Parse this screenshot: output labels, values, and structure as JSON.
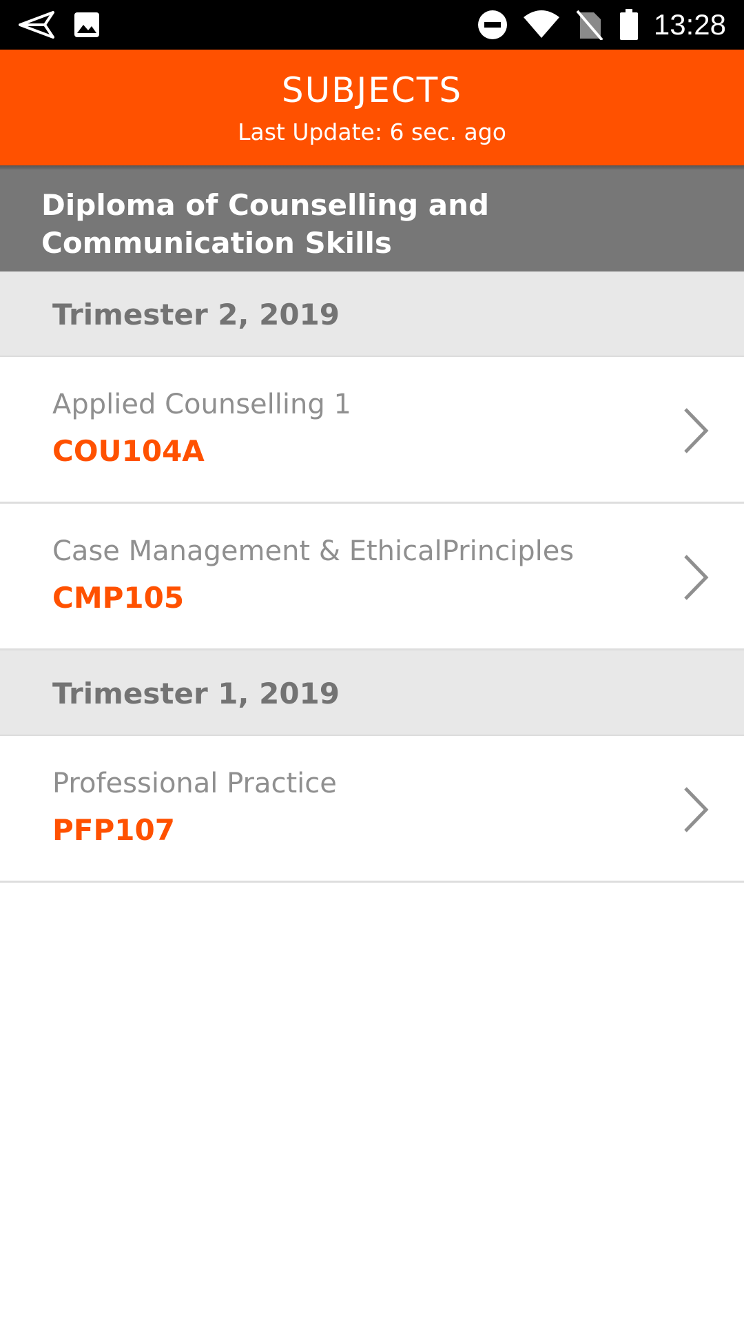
{
  "status_bar": {
    "time": "13:28",
    "icons": [
      "send-notification-icon",
      "image-notification-icon",
      "do-not-disturb-icon",
      "wifi-icon",
      "no-sim-icon",
      "battery-icon"
    ]
  },
  "header": {
    "title": "SUBJECTS",
    "subtitle": "Last Update: 6 sec. ago",
    "color": "#ff5100"
  },
  "program": {
    "title_line1": "Diploma of Counselling and",
    "title_line2": "Communication Skills"
  },
  "sections": [
    {
      "label": "Trimester 2, 2019",
      "subjects": [
        {
          "name": "Applied Counselling 1",
          "code": "COU104A"
        },
        {
          "name": "Case Management & EthicalPrinciples",
          "code": "CMP105"
        }
      ]
    },
    {
      "label": "Trimester 1, 2019",
      "subjects": [
        {
          "name": "Professional Practice",
          "code": "PFP107"
        }
      ]
    }
  ],
  "colors": {
    "accent": "#ff5100",
    "banner": "#777777",
    "section_bg": "#e8e8e8"
  }
}
